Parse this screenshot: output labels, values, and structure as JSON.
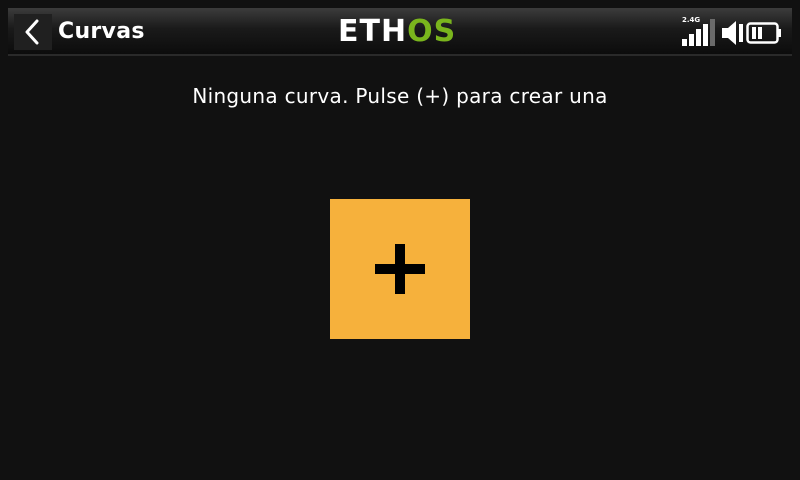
{
  "header": {
    "back_icon": "chevron-left-icon",
    "title": "Curvas",
    "logo_main": "ETH",
    "logo_accent": "OS",
    "logo_accent_color": "#7ab51d",
    "rf_band": "2.4G",
    "signal_icon": "signal-bars-icon",
    "speaker_icon": "speaker-icon",
    "battery_icon": "battery-icon"
  },
  "main": {
    "empty_message": "Ninguna curva. Pulse (+) para crear una",
    "add_icon": "plus-icon",
    "add_button_color": "#f6b13c"
  }
}
